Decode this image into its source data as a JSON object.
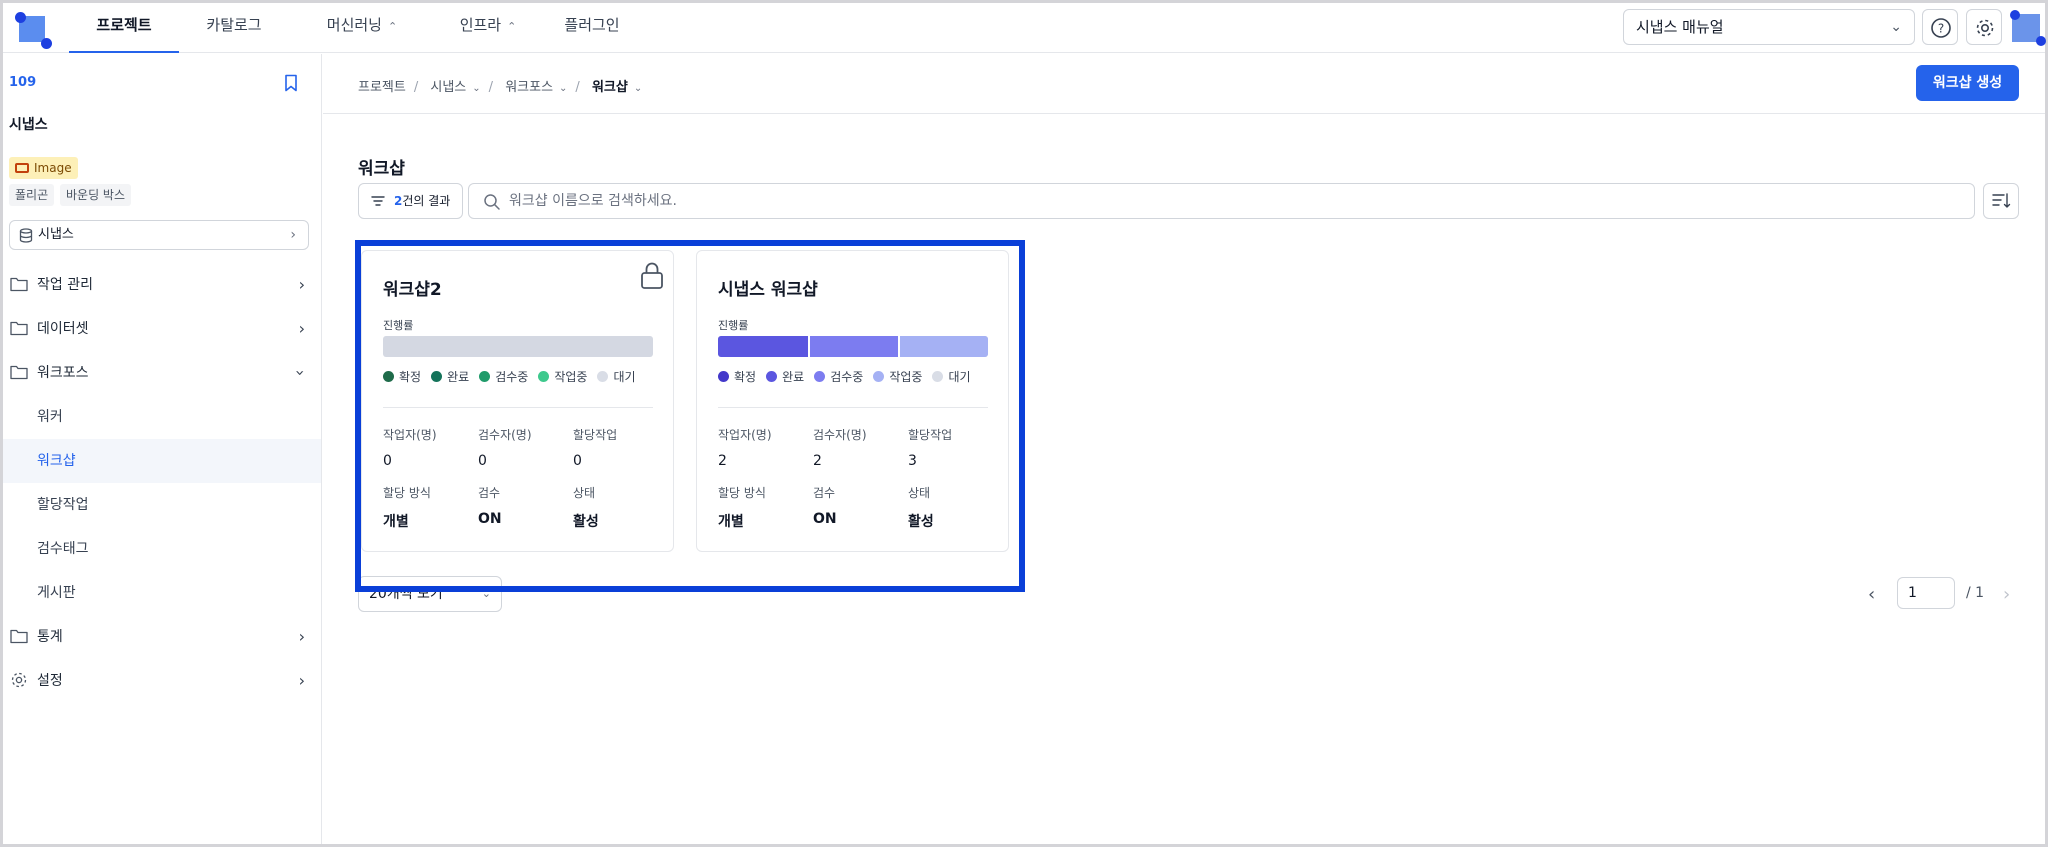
{
  "topbar": {
    "tabs": [
      {
        "label": "프로젝트",
        "active": true
      },
      {
        "label": "카탈로그"
      },
      {
        "label": "머신러닝"
      },
      {
        "label": "인프라"
      },
      {
        "label": "플러그인"
      }
    ],
    "manual_select": "시냅스 매뉴얼"
  },
  "sidebar": {
    "project_id": "109",
    "project_name": "시냅스",
    "type_badge": "Image",
    "tags": [
      "폴리곤",
      "바운딩 박스"
    ],
    "dataset": "시냅스",
    "menu": {
      "task_mgmt": "작업 관리",
      "dataset": "데이터셋",
      "workforce": "워크포스",
      "worker": "워커",
      "workshop": "워크샵",
      "assignment": "할당작업",
      "review_tag": "검수태그",
      "board": "게시판",
      "stats": "통계",
      "settings": "설정"
    }
  },
  "main": {
    "breadcrumb": [
      "프로젝트",
      "시냅스",
      "워크포스",
      "워크샵"
    ],
    "create_button": "워크샵 생성",
    "title": "워크샵",
    "result_count": "2",
    "result_suffix": "건의 결과",
    "search_placeholder": "워크샵 이름으로 검색하세요.",
    "page_size": "20개씩 보기",
    "pager": {
      "current": "1",
      "total": "/ 1"
    }
  },
  "cards": [
    {
      "title": "워크샵2",
      "locked": true,
      "progress_label": "진행률",
      "legend": [
        "확정",
        "완료",
        "검수중",
        "작업중",
        "대기"
      ],
      "legend_colors": [
        "#1f6b4a",
        "#14735a",
        "#1f9b6a",
        "#3ec98d",
        "#d9dde6"
      ],
      "progress": [],
      "stats": {
        "workers_label": "작업자(명)",
        "workers": "0",
        "reviewers_label": "검수자(명)",
        "reviewers": "0",
        "assigned_label": "할당작업",
        "assigned": "0",
        "method_label": "할당 방식",
        "method": "개별",
        "review_label": "검수",
        "review": "ON",
        "status_label": "상태",
        "status": "활성"
      }
    },
    {
      "title": "시냅스 워크샵",
      "locked": false,
      "progress_label": "진행률",
      "legend": [
        "확정",
        "완료",
        "검수중",
        "작업중",
        "대기"
      ],
      "legend_colors": [
        "#4338ca",
        "#5b56e0",
        "#7c7cf0",
        "#a5b1f4",
        "#d9dde6"
      ],
      "progress": [
        {
          "fraction": 0.333,
          "color": "#5b56e0"
        },
        {
          "fraction": 0.333,
          "color": "#7c7cf0"
        },
        {
          "fraction": 0.334,
          "color": "#a5b1f4"
        }
      ],
      "stats": {
        "workers_label": "작업자(명)",
        "workers": "2",
        "reviewers_label": "검수자(명)",
        "reviewers": "2",
        "assigned_label": "할당작업",
        "assigned": "3",
        "method_label": "할당 방식",
        "method": "개별",
        "review_label": "검수",
        "review": "ON",
        "status_label": "상태",
        "status": "활성"
      }
    }
  ]
}
